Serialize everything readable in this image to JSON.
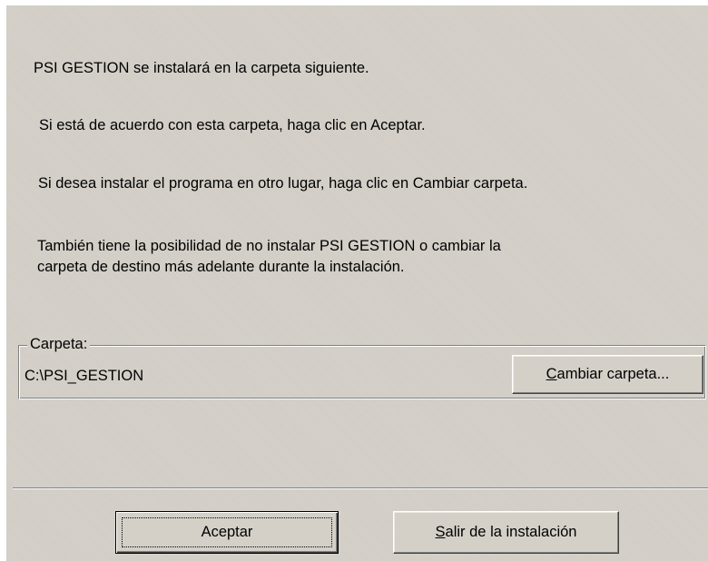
{
  "dialog": {
    "line_intro": "PSI GESTION se instalará en la carpeta siguiente.",
    "line_accept": "Si está de acuerdo con esta carpeta, haga clic en Aceptar.",
    "line_change": "Si desea instalar el programa en otro lugar, haga clic en Cambiar carpeta.",
    "line_later_1": "También tiene la posibilidad de no instalar PSI GESTION o cambiar la",
    "line_later_2": "carpeta de destino más adelante durante la instalación."
  },
  "folder": {
    "group_label": "Carpeta:",
    "path": "C:\\PSI_GESTION",
    "change_button": {
      "mnemonic": "C",
      "rest": "ambiar carpeta..."
    }
  },
  "buttons": {
    "accept": "Aceptar",
    "exit": {
      "mnemonic": "S",
      "rest": "alir de la instalación"
    }
  },
  "colors": {
    "dialog_bg": "#d4d0c8",
    "shadow": "#808080",
    "highlight": "#ffffff"
  }
}
